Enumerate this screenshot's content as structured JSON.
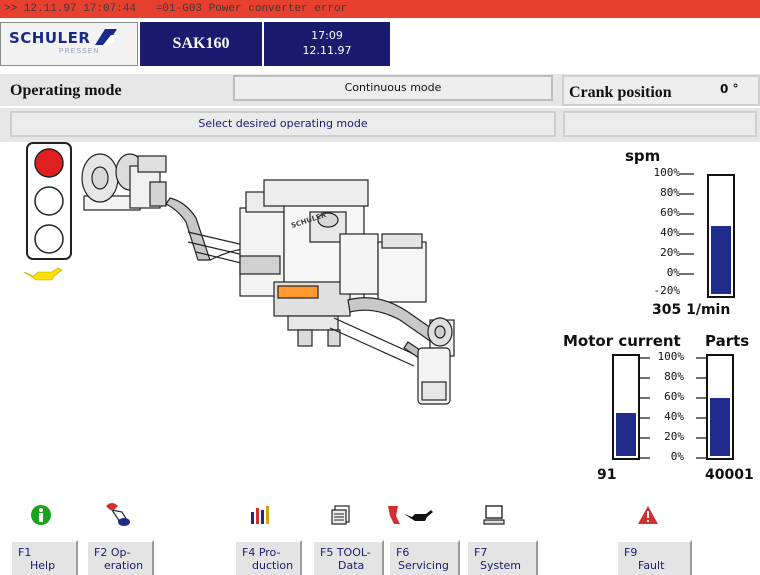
{
  "alarm": {
    "text": ">> 12.11.97 17:07:44   =01-G03 Power converter error"
  },
  "header": {
    "logo": "SCHULER",
    "logo_sub": "PRESSEN",
    "machine": "SAK160",
    "time": "17:09",
    "date": "12.11.97"
  },
  "operating": {
    "label": "Operating mode",
    "mode": "Continuous mode",
    "hint": "Select desired operating mode"
  },
  "crank": {
    "label": "Crank position",
    "value": "0 °"
  },
  "spm_gauge": {
    "title": "spm",
    "scale": [
      "100%",
      "80%",
      "60%",
      "40%",
      "20%",
      "0%",
      "-20%"
    ],
    "fill_percent": 59,
    "value": "305 1/min"
  },
  "motor_gauge": {
    "title": "Motor current",
    "fill_percent": 44,
    "value": "91"
  },
  "parts_gauge": {
    "title": "Parts",
    "fill_percent": 59,
    "value": "40001"
  },
  "shared_scale": [
    "100%",
    "80%",
    "60%",
    "40%",
    "20%",
    "0%"
  ],
  "traffic_light": {
    "state": "red"
  },
  "colors": {
    "alarm": "#e8402e",
    "navy": "#1a1a6e",
    "bar_fill": "#1f2a8a",
    "panel": "#e6e6e6"
  },
  "icons": [
    "info-icon",
    "hand-operation-icon",
    "production-chart-icon",
    "tool-data-icon",
    "servicing-oil-icon",
    "system-computer-icon",
    "fault-warning-icon"
  ],
  "fkeys": [
    {
      "key": "F1",
      "label": "Help"
    },
    {
      "key": "F2",
      "label": "Op-eration"
    },
    {
      "key": "F4",
      "label": "Pro-duction"
    },
    {
      "key": "F5",
      "label": "TOOL-Data"
    },
    {
      "key": "F6",
      "label": "Servicing"
    },
    {
      "key": "F7",
      "label": "System"
    },
    {
      "key": "F9",
      "label": "Fault"
    }
  ],
  "fkey_display": {
    "f1": {
      "line1": "F1",
      "line2": "Help"
    },
    "f2": {
      "line1": "F2  Op-",
      "line2": "eration"
    },
    "f4": {
      "line1": "F4 Pro-",
      "line2": "duction"
    },
    "f5": {
      "line1": "F5 TOOL-",
      "line2": "Data"
    },
    "f6": {
      "line1": "F6",
      "line2": "Servicing"
    },
    "f7": {
      "line1": "F7",
      "line2": "System"
    },
    "f9": {
      "line1": "F9",
      "line2": "Fault"
    }
  }
}
